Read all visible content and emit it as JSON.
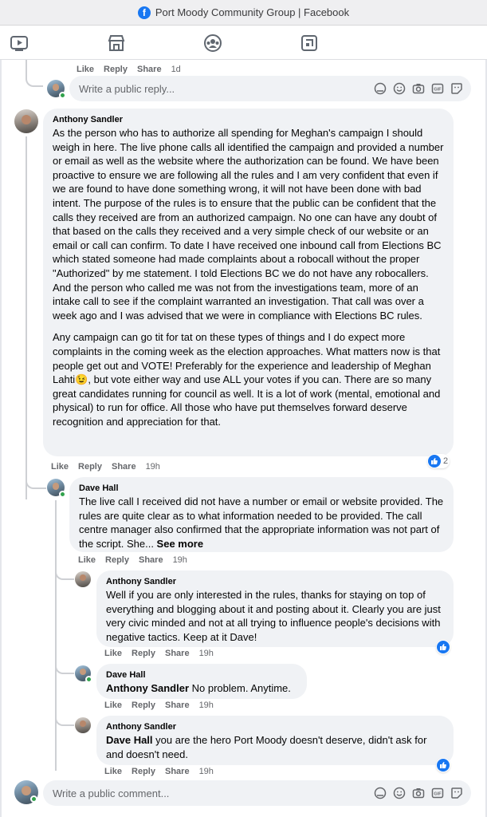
{
  "window": {
    "title": "Port Moody Community Group | Facebook"
  },
  "nav": {
    "icons": [
      "watch-icon",
      "marketplace-icon",
      "groups-icon",
      "gaming-icon"
    ]
  },
  "top_actions": {
    "like": "Like",
    "reply": "Reply",
    "share": "Share",
    "time": "1d"
  },
  "reply_box_top": {
    "placeholder": "Write a public reply..."
  },
  "comments": {
    "main": {
      "author": "Anthony Sandler",
      "paragraph1": "As the person who has to authorize all spending for Meghan's campaign I should weigh in here. The live phone calls all identified the campaign and provided a number or email as well as the website where the authorization can be found. We have been proactive to ensure we are following all the rules and I am very confident that even if we are found to have done something wrong, it will not have been done with bad intent. The purpose of the rules is to ensure that the public can be confident that the calls they received are from an authorized campaign. No one can have any doubt of that based on the calls they received and a very simple check of our website or an email or call can confirm. To date I have received one inbound call from Elections BC which stated someone had made complaints about a robocall without the proper \"Authorized\" by me statement. I told Elections BC we do not have any robocallers. And the person who called me was not from the investigations team, more of an intake call to see if the complaint warranted an investigation. That call was over a week ago and I was advised that we were in compliance with Elections BC rules.",
      "paragraph2a": "Any campaign can go tit for tat on these types of things and I do expect more complaints in the coming week as the election approaches. What matters now is that people get out and VOTE! Preferably for the experience and leadership of Meghan Lahti",
      "emoji": "😉",
      "paragraph2b": ", but vote either way and use ALL your votes if you can. There are so many great candidates running for council as well. It is a lot of work (mental, emotional and physical) to run for office. All those who have put themselves forward deserve recognition and appreciation for that.",
      "reactions": "2",
      "like": "Like",
      "reply": "Reply",
      "share": "Share",
      "time": "19h"
    },
    "reply1": {
      "author": "Dave Hall",
      "text": "The live call I received did not have a number or email or website provided. The rules are quite clear as to what information needed to be provided. The call centre manager also confirmed that the appropriate information was not part of the script. She... ",
      "see_more": "See more",
      "like": "Like",
      "reply": "Reply",
      "share": "Share",
      "time": "19h"
    },
    "reply2": {
      "author": "Anthony Sandler",
      "text": "Well if you are only interested in the rules, thanks for staying on top of everything and blogging about it and posting about it. Clearly you are just very civic minded and not at all trying to influence people's decisions with negative tactics. Keep at it Dave!",
      "like": "Like",
      "reply": "Reply",
      "share": "Share",
      "time": "19h"
    },
    "reply3": {
      "author": "Dave Hall",
      "mention": "Anthony Sandler",
      "text": " No problem. Anytime.",
      "like": "Like",
      "reply": "Reply",
      "share": "Share",
      "time": "19h"
    },
    "reply4": {
      "author": "Anthony Sandler",
      "mention": "Dave Hall",
      "text": " you are the hero Port Moody doesn't deserve, didn't ask for and doesn't need.",
      "like": "Like",
      "reply": "Reply",
      "share": "Share",
      "time": "19h"
    }
  },
  "comment_box": {
    "placeholder": "Write a public comment..."
  },
  "colors": {
    "accent": "#1877f2",
    "bubble": "#f0f2f5",
    "meta": "#65676b",
    "online": "#31a24c"
  }
}
